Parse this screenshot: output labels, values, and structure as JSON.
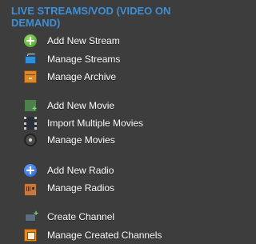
{
  "section": {
    "title": "LIVE STREAMS/VOD (VIDEO ON DEMAND)"
  },
  "menu": {
    "items": [
      {
        "label": "Add New Stream",
        "icon": "add-green-icon"
      },
      {
        "label": "Manage Streams",
        "icon": "tv-icon"
      },
      {
        "label": "Manage Archive",
        "icon": "archive-box-icon"
      },
      {
        "label": "Add New Movie",
        "icon": "add-movie-icon"
      },
      {
        "label": "Import Multiple Movies",
        "icon": "film-strip-icon"
      },
      {
        "label": "Manage Movies",
        "icon": "film-reel-icon"
      },
      {
        "label": "Add New Radio",
        "icon": "add-blue-icon"
      },
      {
        "label": "Manage Radios",
        "icon": "radio-icon"
      },
      {
        "label": "Create Channel",
        "icon": "tv-add-icon"
      },
      {
        "label": "Manage Created Channels",
        "icon": "copy-icon"
      }
    ]
  },
  "colors": {
    "background": "#3d3d3d",
    "title": "#3d8fd6",
    "label": "#ffffff"
  }
}
